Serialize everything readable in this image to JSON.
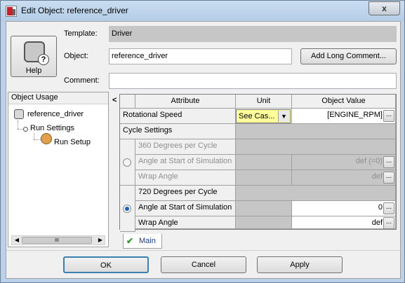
{
  "window": {
    "title": "Edit Object: reference_driver",
    "close_label": "x"
  },
  "header": {
    "help_label": "Help",
    "template_label": "Template:",
    "template_value": "Driver",
    "object_label": "Object:",
    "object_value": "reference_driver",
    "comment_label": "Comment:",
    "comment_value": "",
    "long_comment_button": "Add Long Comment..."
  },
  "usage": {
    "header": "Object Usage",
    "items": [
      {
        "label": "reference_driver",
        "icon": "template-icon"
      },
      {
        "label": "Run Settings",
        "icon": "tree-node-icon"
      },
      {
        "label": "Run Setup",
        "icon": "run-setup-icon"
      }
    ],
    "scroll_thumb": "III",
    "collapse": "<"
  },
  "table": {
    "headers": {
      "attribute": "Attribute",
      "unit": "Unit",
      "value": "Object Value"
    },
    "rows": {
      "rotational_speed": {
        "attribute": "Rotational Speed",
        "unit": "See Cas...",
        "value": "[ENGINE_RPM]"
      },
      "cycle_settings": {
        "attribute": "Cycle Settings"
      },
      "deg360": {
        "attribute": "360 Degrees per Cycle"
      },
      "angle_start_360": {
        "attribute": "Angle at Start of Simulation",
        "value": "def (=0)"
      },
      "wrap_360": {
        "attribute": "Wrap Angle",
        "value": "def"
      },
      "deg720": {
        "attribute": "720 Degrees per Cycle"
      },
      "angle_start_720": {
        "attribute": "Angle at Start of Simulation",
        "value": "0"
      },
      "wrap_720": {
        "attribute": "Wrap Angle",
        "value": "def"
      }
    },
    "dots": "...",
    "dropdown_arrow": "▼",
    "selected_radio": "720"
  },
  "tabs": [
    {
      "label": "Main",
      "icon": "check-icon"
    }
  ],
  "footer": {
    "ok": "OK",
    "cancel": "Cancel",
    "apply": "Apply"
  }
}
